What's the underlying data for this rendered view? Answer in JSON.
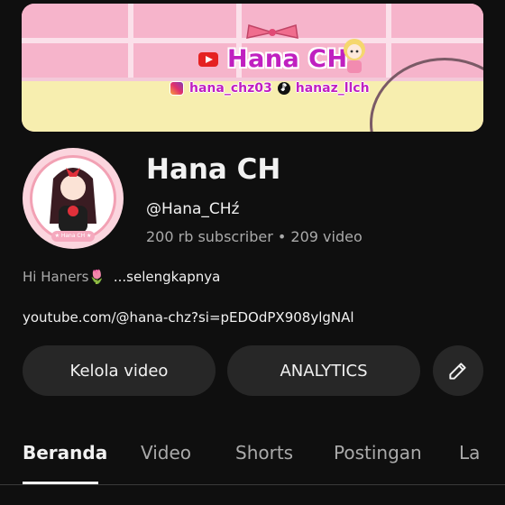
{
  "banner": {
    "title": "Hana CH",
    "instagram": "hana_chz03",
    "tiktok": "hanaz_llch"
  },
  "channel": {
    "name": "Hana CH",
    "handle": "@Hana_CHź",
    "stats": "200 rb subscriber • 209 video",
    "avatar_label": "★ Hana CH ★"
  },
  "description": {
    "text": "Hi Haners🌷",
    "more": "...selengkapnya"
  },
  "link": "youtube.com/@hana-chz?si=pEDOdPX908ylgNAl",
  "buttons": {
    "manage": "Kelola video",
    "analytics": "ANALYTICS"
  },
  "tabs": [
    "Beranda",
    "Video",
    "Shorts",
    "Postingan",
    "La"
  ],
  "colors": {
    "background": "#0f0f0f",
    "button_bg": "#272727",
    "banner_text": "#c020c0"
  }
}
